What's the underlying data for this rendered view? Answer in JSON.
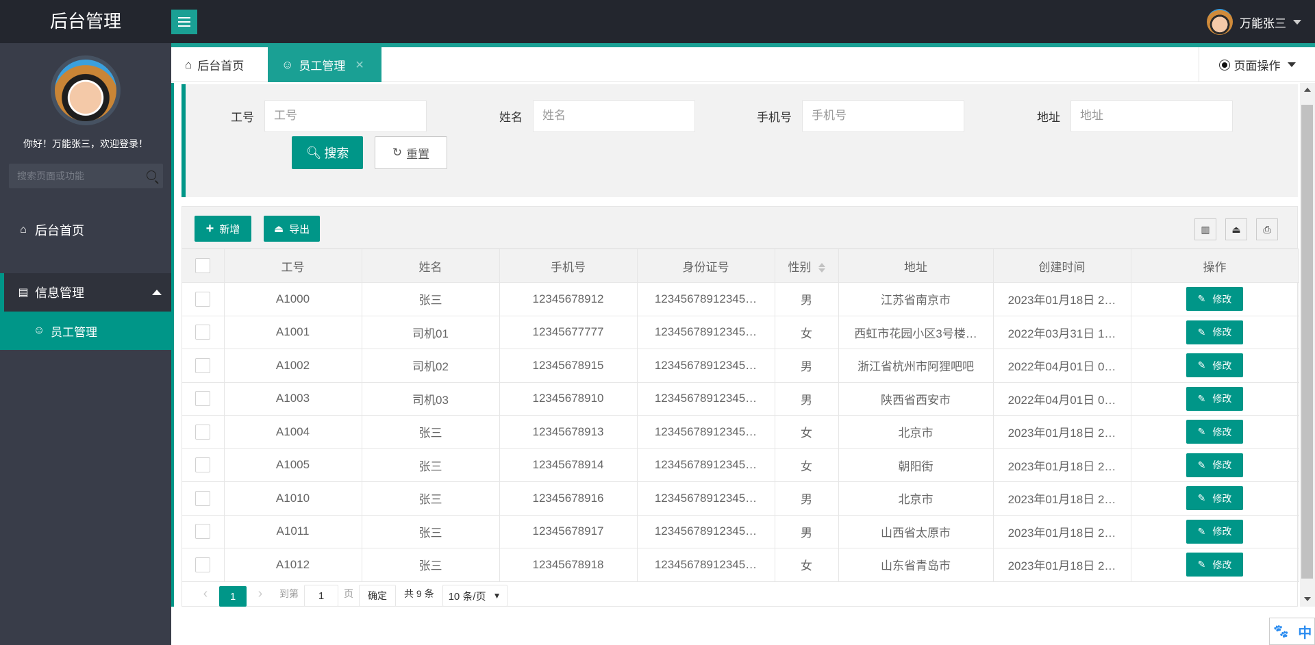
{
  "header": {
    "logo": "后台管理",
    "username": "万能张三"
  },
  "sidebar": {
    "greeting": "你好！万能张三，欢迎登录！",
    "search_placeholder": "搜索页面或功能",
    "items": [
      {
        "label": "后台首页",
        "icon": "home-icon"
      },
      {
        "label": "信息管理",
        "icon": "clipboard-icon",
        "expanded": true
      },
      {
        "label": "员工管理",
        "icon": "user-icon",
        "active": true
      }
    ]
  },
  "tabs": {
    "items": [
      {
        "label": "后台首页",
        "icon": "home-icon"
      },
      {
        "label": "员工管理",
        "icon": "user-icon",
        "active": true,
        "closable": true
      }
    ],
    "page_ops_label": "页面操作"
  },
  "search_form": {
    "fields": [
      {
        "label": "工号",
        "placeholder": "工号",
        "value": ""
      },
      {
        "label": "姓名",
        "placeholder": "姓名",
        "value": ""
      },
      {
        "label": "手机号",
        "placeholder": "手机号",
        "value": ""
      },
      {
        "label": "地址",
        "placeholder": "地址",
        "value": ""
      }
    ],
    "search_label": "搜索",
    "reset_label": "重置"
  },
  "toolbar": {
    "add_label": "新增",
    "export_label": "导出",
    "right_icons": [
      "columns-icon",
      "export-icon",
      "print-icon"
    ]
  },
  "table": {
    "columns": [
      "工号",
      "姓名",
      "手机号",
      "身份证号",
      "性别",
      "地址",
      "创建时间",
      "操作"
    ],
    "edit_label": "修改",
    "rows": [
      {
        "id": "A1000",
        "name": "张三",
        "phone": "12345678912",
        "idcard": "12345678912345…",
        "gender": "男",
        "address": "江苏省南京市",
        "created": "2023年01月18日 2…"
      },
      {
        "id": "A1001",
        "name": "司机01",
        "phone": "12345677777",
        "idcard": "12345678912345…",
        "gender": "女",
        "address": "西虹市花园小区3号楼…",
        "created": "2022年03月31日 1…"
      },
      {
        "id": "A1002",
        "name": "司机02",
        "phone": "12345678915",
        "idcard": "12345678912345…",
        "gender": "男",
        "address": "浙江省杭州市阿狸吧吧",
        "created": "2022年04月01日 0…"
      },
      {
        "id": "A1003",
        "name": "司机03",
        "phone": "12345678910",
        "idcard": "12345678912345…",
        "gender": "男",
        "address": "陕西省西安市",
        "created": "2022年04月01日 0…"
      },
      {
        "id": "A1004",
        "name": "张三",
        "phone": "12345678913",
        "idcard": "12345678912345…",
        "gender": "女",
        "address": "北京市",
        "created": "2023年01月18日 2…"
      },
      {
        "id": "A1005",
        "name": "张三",
        "phone": "12345678914",
        "idcard": "12345678912345…",
        "gender": "女",
        "address": "朝阳街",
        "created": "2023年01月18日 2…"
      },
      {
        "id": "A1010",
        "name": "张三",
        "phone": "12345678916",
        "idcard": "12345678912345…",
        "gender": "男",
        "address": "北京市",
        "created": "2023年01月18日 2…"
      },
      {
        "id": "A1011",
        "name": "张三",
        "phone": "12345678917",
        "idcard": "12345678912345…",
        "gender": "男",
        "address": "山西省太原市",
        "created": "2023年01月18日 2…"
      },
      {
        "id": "A1012",
        "name": "张三",
        "phone": "12345678918",
        "idcard": "12345678912345…",
        "gender": "女",
        "address": "山东省青岛市",
        "created": "2023年01月18日 2…"
      }
    ]
  },
  "pagination": {
    "current_page": "1",
    "goto_prefix": "到第",
    "goto_value": "1",
    "goto_suffix": "页",
    "confirm_label": "确定",
    "total_label": "共 9 条",
    "page_size_label": "10 条/页"
  },
  "ime": {
    "label": "中"
  },
  "colors": {
    "accent": "#009688",
    "accent_light": "#1aa094",
    "header_bg": "#23262e",
    "sidebar_bg": "#393d49"
  }
}
